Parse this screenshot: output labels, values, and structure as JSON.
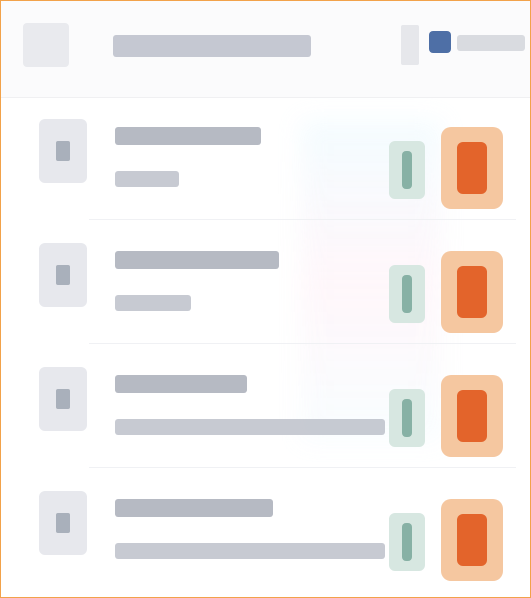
{
  "colors": {
    "frame_border": "#f2a24a",
    "accent_orange": "#e3642b",
    "accent_blue": "#4e6fa6",
    "accent_green": "#79a79a"
  },
  "header": {
    "left_icon": "app-icon",
    "right_icon": "user-icon"
  },
  "list": {
    "rows": [
      {
        "thumb_icon": "file-icon",
        "mid_icon": "bookmark-icon",
        "right_icon": "phone-icon"
      },
      {
        "thumb_icon": "file-icon",
        "mid_icon": "bookmark-icon",
        "right_icon": "phone-icon"
      },
      {
        "thumb_icon": "file-icon",
        "mid_icon": "bookmark-icon",
        "right_icon": "phone-icon"
      },
      {
        "thumb_icon": "file-icon",
        "mid_icon": "bookmark-icon",
        "right_icon": "phone-icon"
      }
    ]
  }
}
